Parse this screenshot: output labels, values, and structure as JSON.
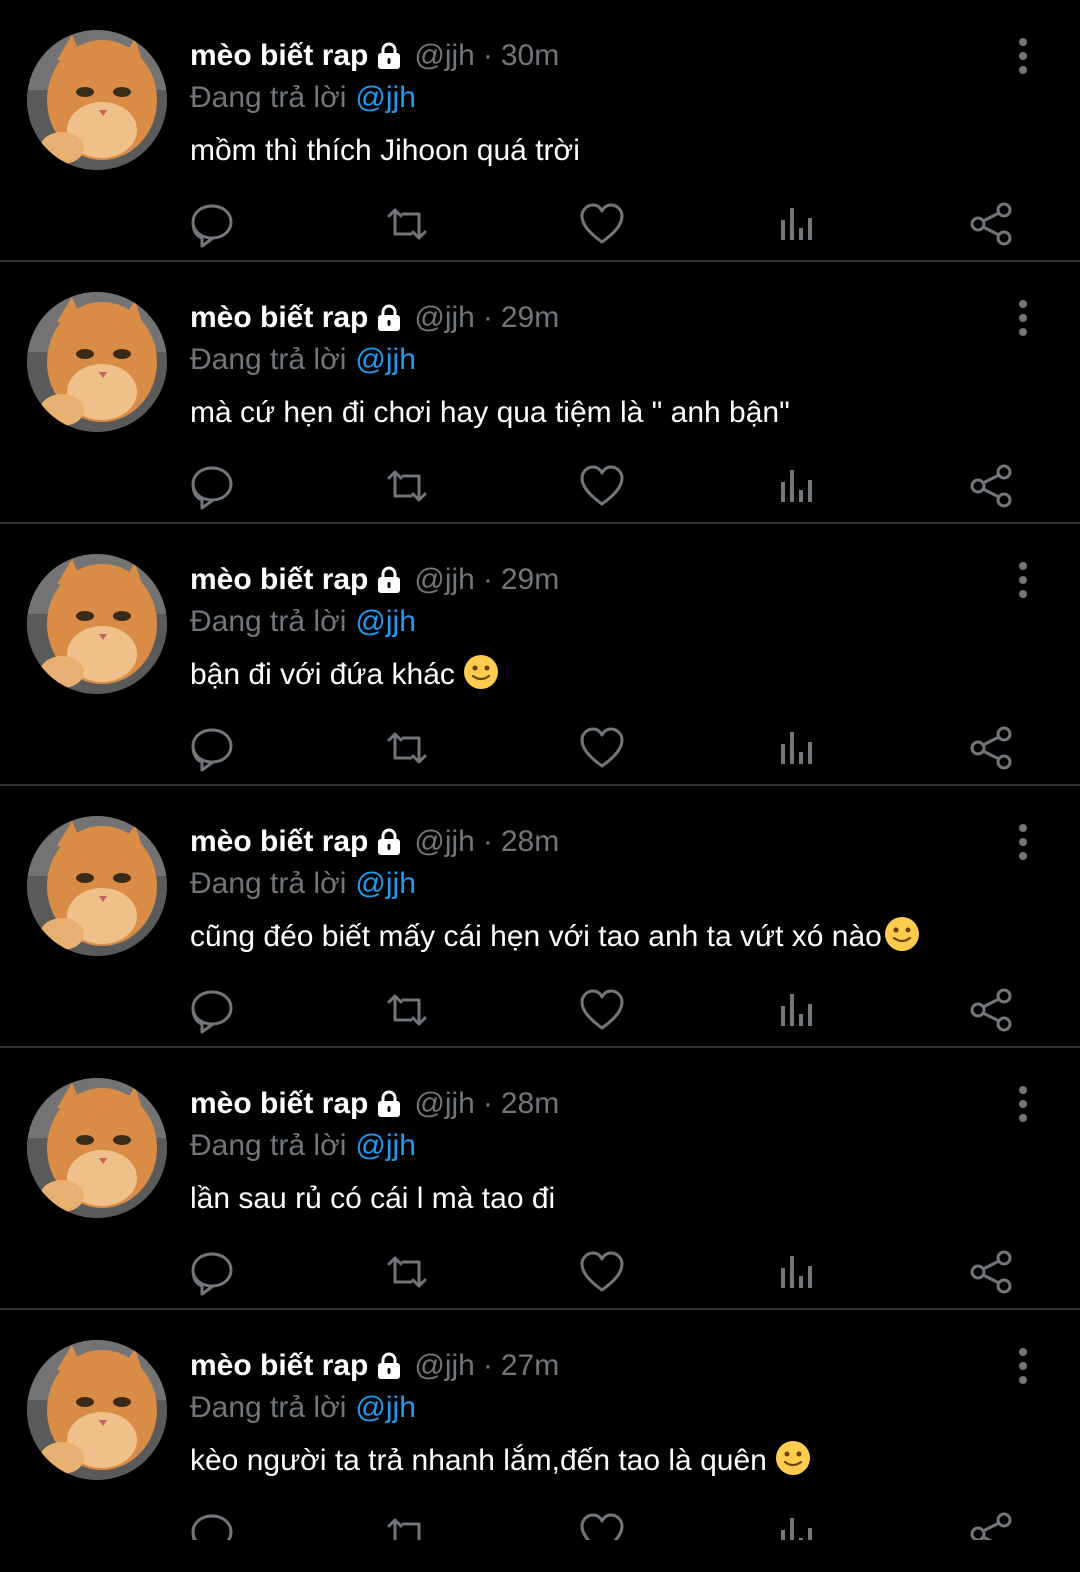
{
  "colors": {
    "background": "#000000",
    "name": "#ffffff",
    "secondary": "#71767b",
    "mention": "#1d9bf0",
    "icon": "#71767b",
    "divider": "#2f3336"
  },
  "icons": {
    "lock": "lock-icon",
    "more": "more-vertical-icon",
    "reply": "reply-icon",
    "retweet": "retweet-icon",
    "like": "heart-icon",
    "views": "views-icon",
    "share": "share-icon",
    "emoji": "slightly-smiling-face-emoji"
  },
  "tweets": [
    {
      "name": "mèo biết rap",
      "handle": "@jjh",
      "separator": "·",
      "time": "30m",
      "reply_prefix": "Đang trả lời",
      "reply_to": "@jjh",
      "text": "mồm thì thích Jihoon quá trời",
      "emoji": false
    },
    {
      "name": "mèo biết rap",
      "handle": "@jjh",
      "separator": "·",
      "time": "29m",
      "reply_prefix": "Đang trả lời",
      "reply_to": "@jjh",
      "text": "mà cứ hẹn đi chơi hay qua tiệm là \" anh bận\"",
      "emoji": false
    },
    {
      "name": "mèo biết rap",
      "handle": "@jjh",
      "separator": "·",
      "time": "29m",
      "reply_prefix": "Đang trả lời",
      "reply_to": "@jjh",
      "text": "bận đi với đứa khác",
      "emoji": true
    },
    {
      "name": "mèo biết rap",
      "handle": "@jjh",
      "separator": "·",
      "time": "28m",
      "reply_prefix": "Đang trả lời",
      "reply_to": "@jjh",
      "text": "cũng đéo biết mấy cái hẹn với tao anh ta vứt xó nào",
      "emoji": true
    },
    {
      "name": "mèo biết rap",
      "handle": "@jjh",
      "separator": "·",
      "time": "28m",
      "reply_prefix": "Đang trả lời",
      "reply_to": "@jjh",
      "text": "lần sau rủ có cái l mà tao đi",
      "emoji": false
    },
    {
      "name": "mèo biết rap",
      "handle": "@jjh",
      "separator": "·",
      "time": "27m",
      "reply_prefix": "Đang trả lời",
      "reply_to": "@jjh",
      "text": "kèo người ta trả nhanh lắm,đến tao là quên",
      "emoji": true
    }
  ]
}
